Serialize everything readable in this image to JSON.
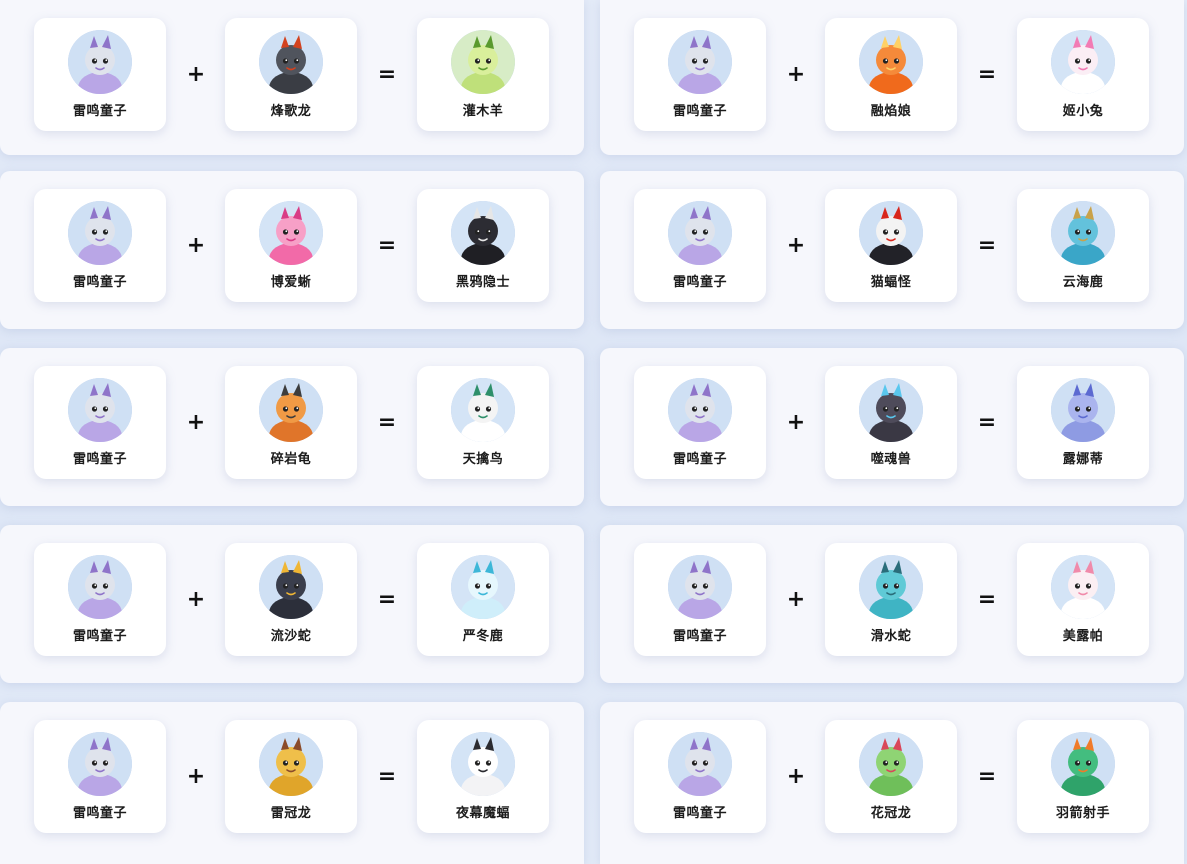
{
  "operators": {
    "plus": "+",
    "equals": "="
  },
  "combos": [
    {
      "a": {
        "name": "雷鸣童子",
        "icon": "leiming-tongzi-icon"
      },
      "b": {
        "name": "烽歌龙",
        "icon": "fengge-long-icon"
      },
      "result": {
        "name": "灌木羊",
        "icon": "guanmu-yang-icon"
      }
    },
    {
      "a": {
        "name": "雷鸣童子",
        "icon": "leiming-tongzi-icon"
      },
      "b": {
        "name": "融焰娘",
        "icon": "rongyan-niang-icon"
      },
      "result": {
        "name": "姬小兔",
        "icon": "ji-xiaotu-icon"
      }
    },
    {
      "a": {
        "name": "雷鸣童子",
        "icon": "leiming-tongzi-icon"
      },
      "b": {
        "name": "博爱蜥",
        "icon": "boai-xi-icon"
      },
      "result": {
        "name": "黑鸦隐士",
        "icon": "heiya-yinshi-icon"
      }
    },
    {
      "a": {
        "name": "雷鸣童子",
        "icon": "leiming-tongzi-icon"
      },
      "b": {
        "name": "猫蝠怪",
        "icon": "maofu-guai-icon"
      },
      "result": {
        "name": "云海鹿",
        "icon": "yunhai-lu-icon"
      }
    },
    {
      "a": {
        "name": "雷鸣童子",
        "icon": "leiming-tongzi-icon"
      },
      "b": {
        "name": "碎岩龟",
        "icon": "suiyan-gui-icon"
      },
      "result": {
        "name": "天擒鸟",
        "icon": "tianqin-niao-icon"
      }
    },
    {
      "a": {
        "name": "雷鸣童子",
        "icon": "leiming-tongzi-icon"
      },
      "b": {
        "name": "噬魂兽",
        "icon": "shihun-shou-icon"
      },
      "result": {
        "name": "露娜蒂",
        "icon": "luna-di-icon"
      }
    },
    {
      "a": {
        "name": "雷鸣童子",
        "icon": "leiming-tongzi-icon"
      },
      "b": {
        "name": "流沙蛇",
        "icon": "liusha-she-icon"
      },
      "result": {
        "name": "严冬鹿",
        "icon": "yandong-lu-icon"
      }
    },
    {
      "a": {
        "name": "雷鸣童子",
        "icon": "leiming-tongzi-icon"
      },
      "b": {
        "name": "滑水蛇",
        "icon": "huashui-she-icon"
      },
      "result": {
        "name": "美露帕",
        "icon": "meilu-pa-icon"
      }
    },
    {
      "a": {
        "name": "雷鸣童子",
        "icon": "leiming-tongzi-icon"
      },
      "b": {
        "name": "雷冠龙",
        "icon": "leiguan-long-icon"
      },
      "result": {
        "name": "夜幕魔蝠",
        "icon": "yemu-mofu-icon"
      }
    },
    {
      "a": {
        "name": "雷鸣童子",
        "icon": "leiming-tongzi-icon"
      },
      "b": {
        "name": "花冠龙",
        "icon": "huaguan-long-icon"
      },
      "result": {
        "name": "羽箭射手",
        "icon": "yujian-sheshou-icon"
      }
    }
  ]
}
